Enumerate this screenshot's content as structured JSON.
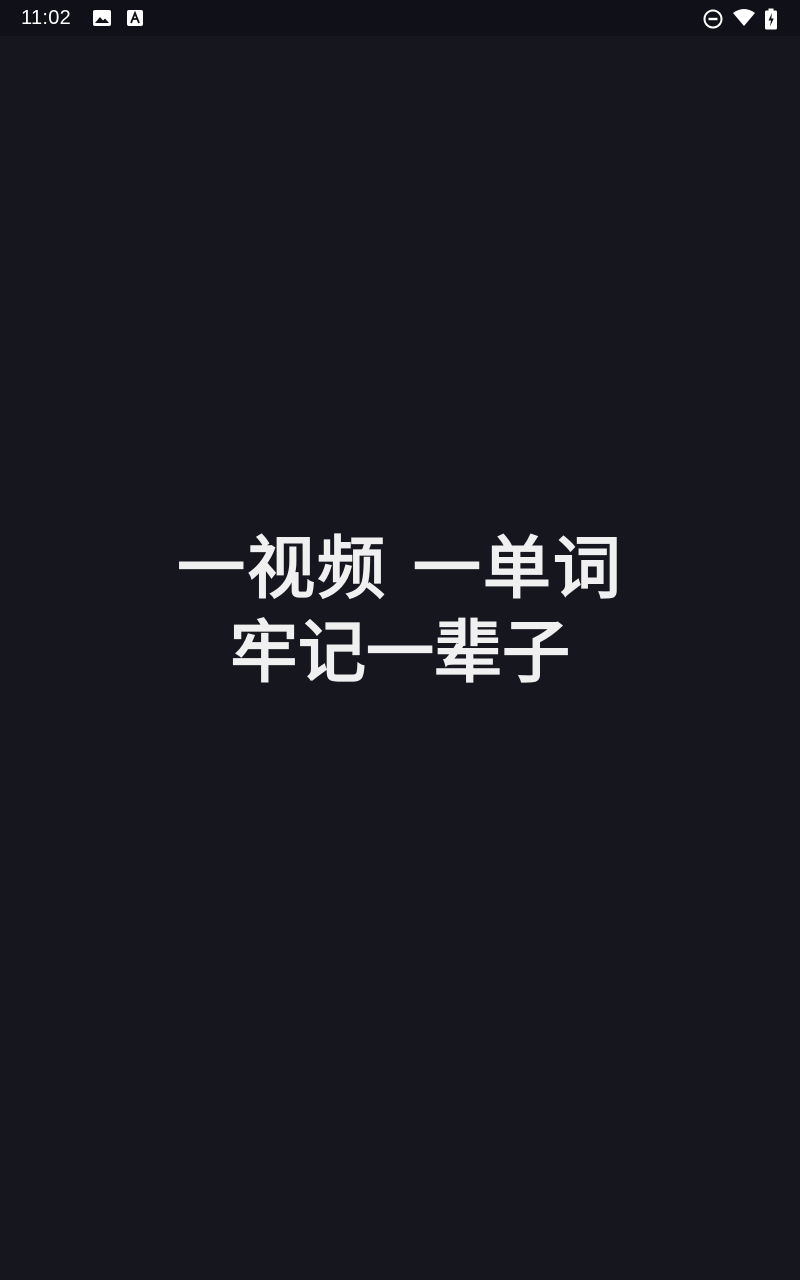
{
  "status_bar": {
    "time": "11:02",
    "left_icons": [
      "image-icon",
      "text-a-icon"
    ],
    "right_icons": [
      "do-not-disturb-icon",
      "wifi-icon",
      "battery-charging-icon"
    ]
  },
  "splash": {
    "line1": "一视频 一单词",
    "line2": "牢记一辈子"
  },
  "colors": {
    "background": "#16161e",
    "status_bar": "#101018",
    "text": "#f0f0f0"
  }
}
